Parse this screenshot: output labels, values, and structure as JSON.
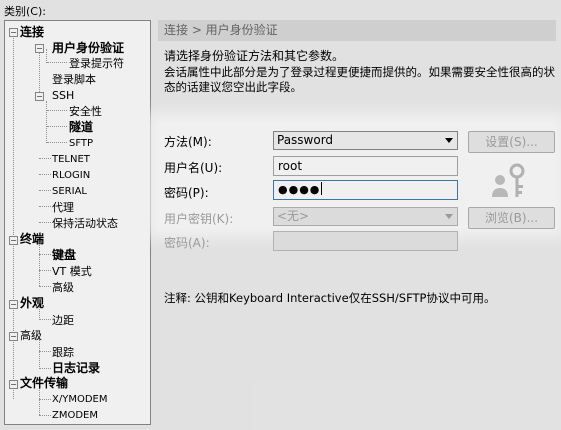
{
  "category_label": "类别(C):",
  "tree": {
    "items": [
      {
        "label": "连接",
        "icon": "minus-icon"
      },
      {
        "label": "用户身份验证",
        "icon": "minus-icon"
      },
      {
        "label": "登录提示符"
      },
      {
        "label": "登录脚本"
      },
      {
        "label": "SSH",
        "icon": "minus-icon"
      },
      {
        "label": "安全性"
      },
      {
        "label": "隧道"
      },
      {
        "label": "SFTP"
      },
      {
        "label": "TELNET"
      },
      {
        "label": "RLOGIN"
      },
      {
        "label": "SERIAL"
      },
      {
        "label": "代理"
      },
      {
        "label": "保持活动状态"
      },
      {
        "label": "终端",
        "icon": "minus-icon"
      },
      {
        "label": "键盘"
      },
      {
        "label": "VT 模式"
      },
      {
        "label": "高级"
      },
      {
        "label": "外观",
        "icon": "minus-icon"
      },
      {
        "label": "边距"
      },
      {
        "label": "高级",
        "icon": "minus-icon"
      },
      {
        "label": "跟踪"
      },
      {
        "label": "日志记录"
      },
      {
        "label": "文件传输",
        "icon": "minus-icon"
      },
      {
        "label": "X/YMODEM"
      },
      {
        "label": "ZMODEM"
      }
    ]
  },
  "panel": {
    "title": "连接 > 用户身份验证",
    "intro": "请选择身份验证方法和其它参数。",
    "description": "会话属性中此部分是为了登录过程更便捷而提供的。如果需要安全性很高的状态的话建议您空出此字段。",
    "method_label": "方法(M):",
    "method_value": "Password",
    "settings_button": "设置(S)...",
    "username_label": "用户名(U):",
    "username_value": "root",
    "password_label": "密码(P):",
    "password_value": "●●●●",
    "userkey_label": "用户密钥(K):",
    "userkey_value": "<无>",
    "browse_button": "浏览(B)...",
    "passphrase_label": "密码(A):",
    "note": "注释: 公钥和Keyboard Interactive仅在SSH/SFTP协议中可用。",
    "key_icon": "user-key-icon"
  }
}
